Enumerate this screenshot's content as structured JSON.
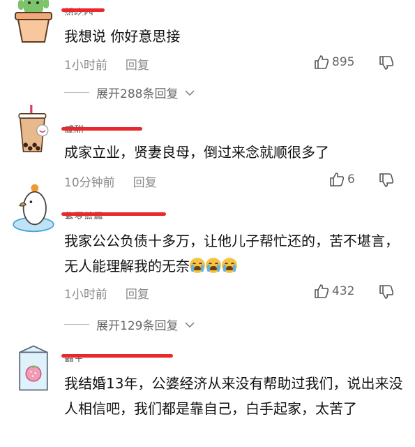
{
  "comments": [
    {
      "name": "想吃西",
      "text": "我想说 你好意思接",
      "time": "1小时前",
      "reply": "回复",
      "likes": "895",
      "expand": "展开288条回复"
    },
    {
      "name": "咸甜",
      "text": "成家立业，贤妻良母，倒过来念就顺很多了",
      "time": "10分钟前",
      "reply": "回复",
      "likes": "6"
    },
    {
      "name": "紫罗蓝晨",
      "text": "我家公公负债十多万，让他儿子帮忙还的，苦不堪言，无人能理解我的无奈",
      "time": "1小时前",
      "reply": "回复",
      "likes": "432",
      "expand": "展开129条回复"
    },
    {
      "name": "霸王",
      "text": "我结婚13年，公婆经济从来没有帮助过我们，说出来没人相信吧，我们都是靠自己，白手起家，太苦了"
    }
  ],
  "icons": {
    "like": "thumbs-up-icon",
    "dislike": "thumbs-down-icon",
    "expand": "chevron-down-icon",
    "crying": "loudly-crying-face-emoji"
  },
  "colors": {
    "redaction": "#e8282a",
    "meta": "#8a8a8a"
  }
}
